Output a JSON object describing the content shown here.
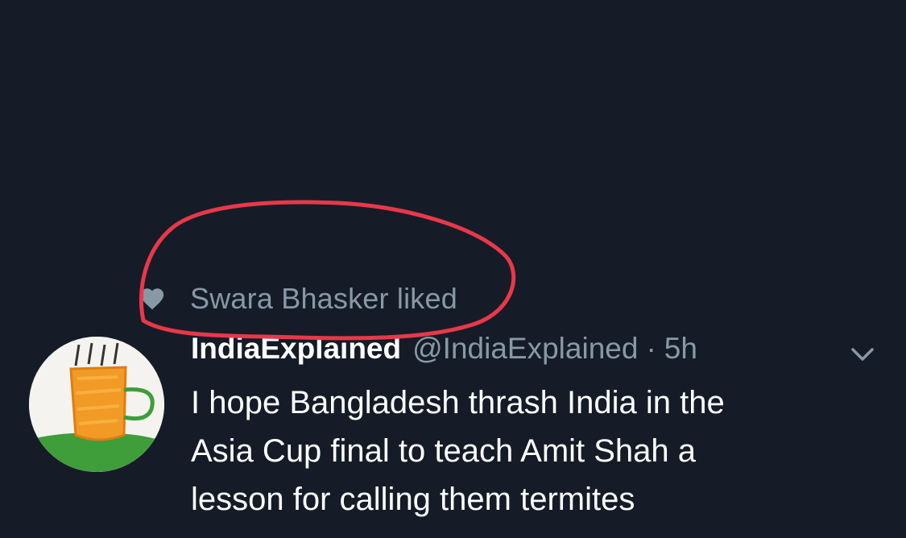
{
  "social_context": {
    "icon": "heart-icon",
    "text": "Swara Bhasker liked"
  },
  "tweet": {
    "display_name": "IndiaExplained",
    "handle": "@IndiaExplained",
    "separator": "·",
    "time": "5h",
    "text_lines": [
      "I hope Bangladesh thrash India in the",
      "Asia Cup final to teach Amit Shah a",
      "lesson for calling them termites"
    ],
    "avatar_icon": "tea-cup-avatar",
    "menu_icon": "chevron-down-icon"
  },
  "colors": {
    "background": "#151c27",
    "primary_text": "#ffffff",
    "secondary_text": "#8899a6",
    "annotation": "#e8384a"
  }
}
